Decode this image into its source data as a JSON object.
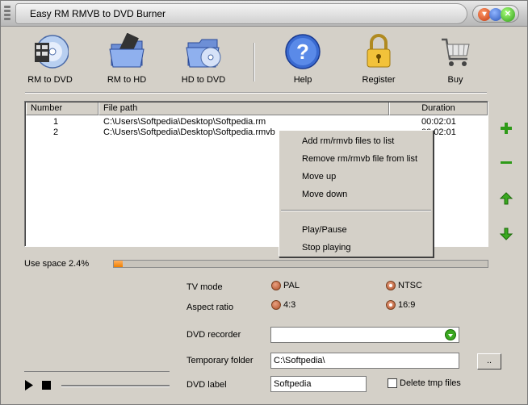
{
  "window": {
    "title": "Easy RM RMVB to DVD Burner"
  },
  "toolbar": {
    "rm_to_dvd": "RM to DVD",
    "rm_to_hd": "RM to HD",
    "hd_to_dvd": "HD to DVD",
    "help": "Help",
    "register": "Register",
    "buy": "Buy"
  },
  "list": {
    "columns": [
      "Number",
      "File path",
      "Duration"
    ],
    "rows": [
      {
        "number": "1",
        "path": "C:\\Users\\Softpedia\\Desktop\\Softpedia.rm",
        "duration": "00:02:01"
      },
      {
        "number": "2",
        "path": "C:\\Users\\Softpedia\\Desktop\\Softpedia.rmvb",
        "duration": "00:02:01"
      }
    ]
  },
  "context_menu": {
    "items": [
      "Add rm/rmvb files to list",
      "Remove rm/rmvb file from list",
      "Move up",
      "Move down",
      "Play/Pause",
      "Stop playing"
    ]
  },
  "side_icons": [
    "plus-icon",
    "minus-icon",
    "arrow-up-icon",
    "arrow-down-icon"
  ],
  "usage": {
    "label": "Use space 2.4%",
    "percent": 2.4
  },
  "settings": {
    "tv_mode_label": "TV mode",
    "pal": "PAL",
    "ntsc": "NTSC",
    "tv_mode_selected": "NTSC",
    "aspect_label": "Aspect ratio",
    "aspect_4_3": "4:3",
    "aspect_16_9": "16:9",
    "aspect_selected": "16:9",
    "dvd_recorder_label": "DVD recorder",
    "dvd_recorder_value": "",
    "temp_folder_label": "Temporary folder",
    "temp_folder_value": "C:\\Softpedia\\",
    "browse_label": "..",
    "dvd_label_label": "DVD label",
    "dvd_label_value": "Softpedia",
    "delete_tmp_label": "Delete tmp files"
  },
  "colors": {
    "accent_orange": "#f08000",
    "plus_green": "#2e9a18"
  }
}
